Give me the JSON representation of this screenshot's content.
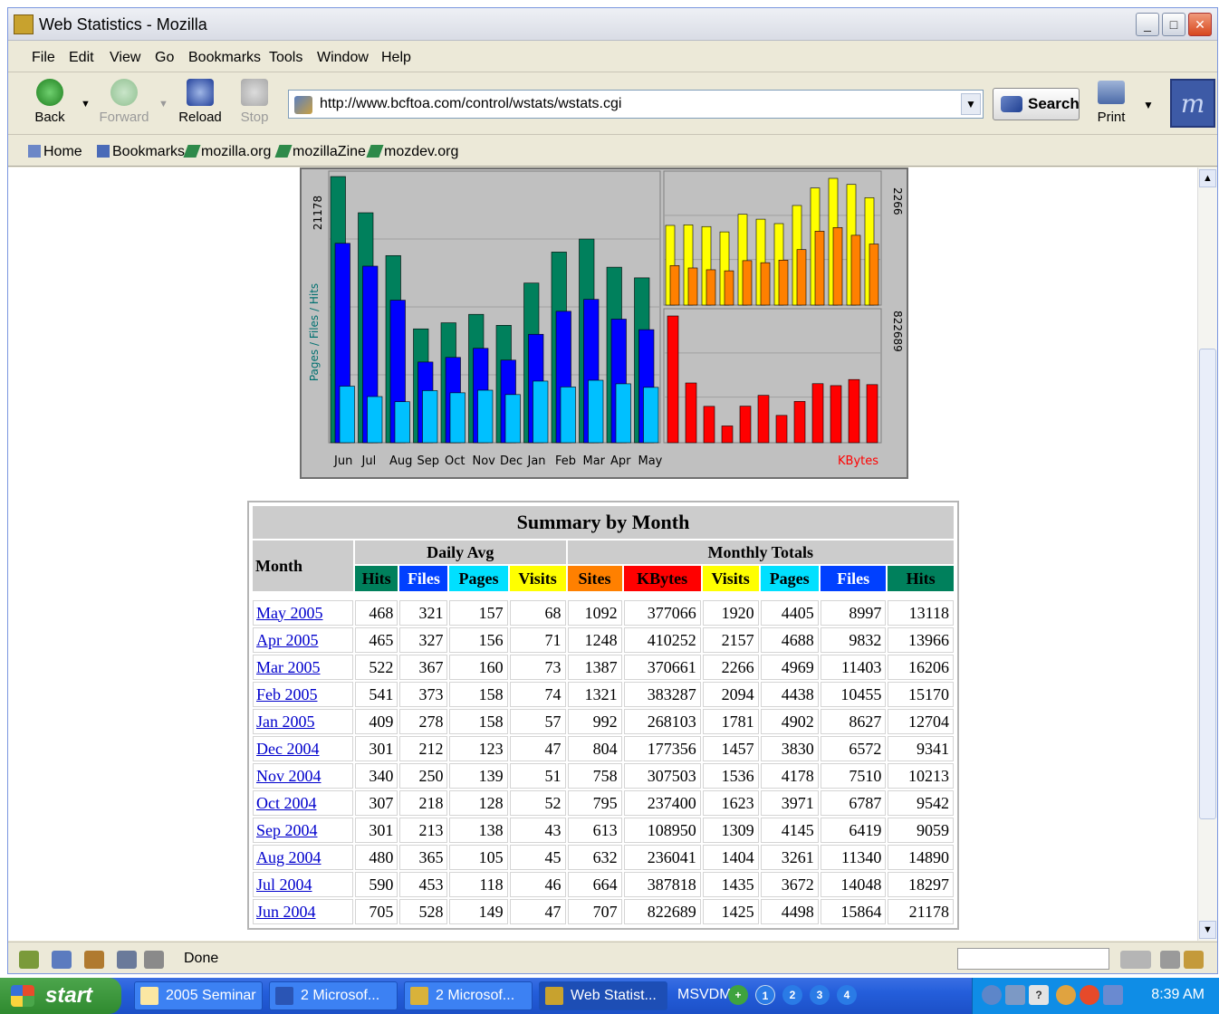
{
  "window": {
    "title": "Web Statistics - Mozilla"
  },
  "menu": [
    "File",
    "Edit",
    "View",
    "Go",
    "Bookmarks",
    "Tools",
    "Window",
    "Help"
  ],
  "nav": {
    "back": "Back",
    "forward": "Forward",
    "reload": "Reload",
    "stop": "Stop",
    "print": "Print",
    "search": "Search"
  },
  "url": "http://www.bcftoa.com/control/wstats/wstats.cgi",
  "bookmarks": [
    "Home",
    "Bookmarks",
    "mozilla.org",
    "mozillaZine",
    "mozdev.org"
  ],
  "status": {
    "text": "Done"
  },
  "taskbar": {
    "start": "start",
    "tasks": [
      "2005 Seminar",
      "2 Microsof...",
      "2 Microsof...",
      "Web Statist..."
    ],
    "msvdm": "MSVDM",
    "clock": "8:39 AM",
    "tray_numbers": [
      "1",
      "2",
      "3",
      "4"
    ]
  },
  "chart_data": [
    {
      "type": "bar",
      "categories": [
        "Jun",
        "Jul",
        "Aug",
        "Sep",
        "Oct",
        "Nov",
        "Dec",
        "Jan",
        "Feb",
        "Mar",
        "Apr",
        "May"
      ],
      "ylabel": "Pages / Files / Hits",
      "ymax_label": "21178",
      "series": [
        {
          "name": "Hits",
          "color": "#00805c",
          "values": [
            21178,
            18297,
            14890,
            9059,
            9542,
            10213,
            9341,
            12704,
            15170,
            16206,
            13966,
            13118
          ]
        },
        {
          "name": "Files",
          "color": "#0000ff",
          "values": [
            15864,
            14048,
            11340,
            6419,
            6787,
            7510,
            6572,
            8627,
            10455,
            11403,
            9832,
            8997
          ]
        },
        {
          "name": "Pages",
          "color": "#00c0ff",
          "values": [
            4498,
            3672,
            3261,
            4145,
            3971,
            4178,
            3830,
            4902,
            4438,
            4969,
            4688,
            4405
          ]
        }
      ]
    },
    {
      "type": "bar",
      "categories": [
        "Jun",
        "Jul",
        "Aug",
        "Sep",
        "Oct",
        "Nov",
        "Dec",
        "Jan",
        "Feb",
        "Mar",
        "Apr",
        "May"
      ],
      "ymax_label": "2266",
      "series": [
        {
          "name": "Visits",
          "color": "#ffff00",
          "values": [
            1425,
            1435,
            1404,
            1309,
            1623,
            1536,
            1457,
            1781,
            2094,
            2266,
            2157,
            1920
          ]
        },
        {
          "name": "Sites",
          "color": "#ff8000",
          "values": [
            707,
            664,
            632,
            613,
            795,
            758,
            804,
            992,
            1321,
            1387,
            1248,
            1092
          ]
        }
      ]
    },
    {
      "type": "bar",
      "categories": [
        "Jun",
        "Jul",
        "Aug",
        "Sep",
        "Oct",
        "Nov",
        "Dec",
        "Jan",
        "Feb",
        "Mar",
        "Apr",
        "May"
      ],
      "ymax_label": "822689",
      "xlabel": "KBytes",
      "series": [
        {
          "name": "KBytes",
          "color": "#ff0000",
          "values": [
            822689,
            387818,
            236041,
            108950,
            237400,
            307503,
            177356,
            268103,
            383287,
            370661,
            410252,
            377066
          ]
        }
      ]
    }
  ],
  "summary": {
    "title": "Summary by Month",
    "month_header": "Month",
    "daily_avg": "Daily Avg",
    "monthly_totals": "Monthly Totals",
    "columns": [
      {
        "label": "Hits",
        "bg": "#00805c",
        "fg": "#000000"
      },
      {
        "label": "Files",
        "bg": "#0040ff",
        "fg": "#ffffff"
      },
      {
        "label": "Pages",
        "bg": "#00e0ff",
        "fg": "#000000"
      },
      {
        "label": "Visits",
        "bg": "#ffff00",
        "fg": "#000000"
      },
      {
        "label": "Sites",
        "bg": "#ff8000",
        "fg": "#000000"
      },
      {
        "label": "KBytes",
        "bg": "#ff0000",
        "fg": "#000000"
      },
      {
        "label": "Visits",
        "bg": "#ffff00",
        "fg": "#000000"
      },
      {
        "label": "Pages",
        "bg": "#00e0ff",
        "fg": "#000000"
      },
      {
        "label": "Files",
        "bg": "#0040ff",
        "fg": "#ffffff"
      },
      {
        "label": "Hits",
        "bg": "#00805c",
        "fg": "#000000"
      }
    ],
    "rows": [
      [
        "May 2005",
        "468",
        "321",
        "157",
        "68",
        "1092",
        "377066",
        "1920",
        "4405",
        "8997",
        "13118"
      ],
      [
        "Apr 2005",
        "465",
        "327",
        "156",
        "71",
        "1248",
        "410252",
        "2157",
        "4688",
        "9832",
        "13966"
      ],
      [
        "Mar 2005",
        "522",
        "367",
        "160",
        "73",
        "1387",
        "370661",
        "2266",
        "4969",
        "11403",
        "16206"
      ],
      [
        "Feb 2005",
        "541",
        "373",
        "158",
        "74",
        "1321",
        "383287",
        "2094",
        "4438",
        "10455",
        "15170"
      ],
      [
        "Jan 2005",
        "409",
        "278",
        "158",
        "57",
        "992",
        "268103",
        "1781",
        "4902",
        "8627",
        "12704"
      ],
      [
        "Dec 2004",
        "301",
        "212",
        "123",
        "47",
        "804",
        "177356",
        "1457",
        "3830",
        "6572",
        "9341"
      ],
      [
        "Nov 2004",
        "340",
        "250",
        "139",
        "51",
        "758",
        "307503",
        "1536",
        "4178",
        "7510",
        "10213"
      ],
      [
        "Oct 2004",
        "307",
        "218",
        "128",
        "52",
        "795",
        "237400",
        "1623",
        "3971",
        "6787",
        "9542"
      ],
      [
        "Sep 2004",
        "301",
        "213",
        "138",
        "43",
        "613",
        "108950",
        "1309",
        "4145",
        "6419",
        "9059"
      ],
      [
        "Aug 2004",
        "480",
        "365",
        "105",
        "45",
        "632",
        "236041",
        "1404",
        "3261",
        "11340",
        "14890"
      ],
      [
        "Jul 2004",
        "590",
        "453",
        "118",
        "46",
        "664",
        "387818",
        "1435",
        "3672",
        "14048",
        "18297"
      ],
      [
        "Jun 2004",
        "705",
        "528",
        "149",
        "47",
        "707",
        "822689",
        "1425",
        "4498",
        "15864",
        "21178"
      ]
    ]
  }
}
